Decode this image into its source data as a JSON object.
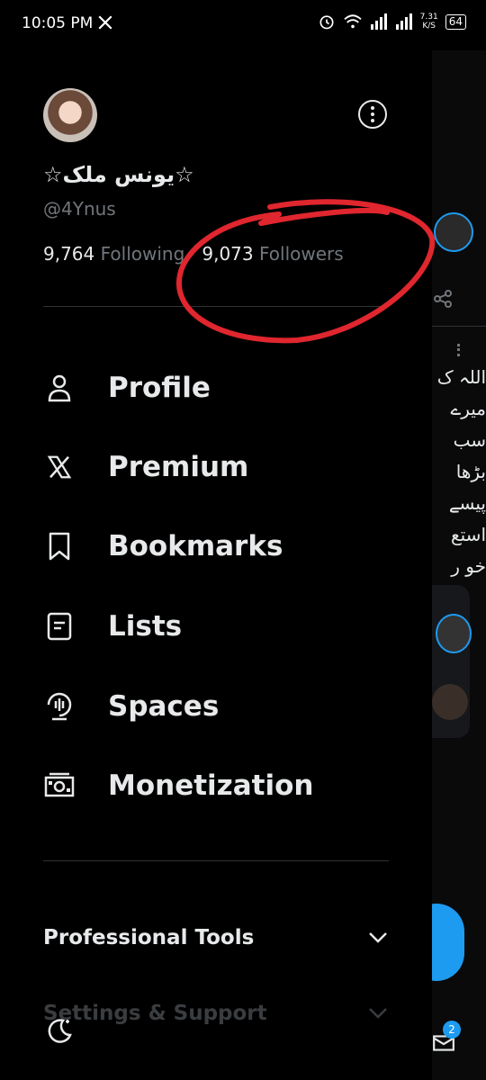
{
  "status_bar": {
    "time": "10:05 PM",
    "network_speed_value": "7.31",
    "network_speed_unit": "K/S",
    "battery": "64"
  },
  "profile": {
    "display_name": "☆یونس ملک☆",
    "handle": "@4Ynus",
    "following_count": "9,764",
    "following_label": "Following",
    "followers_count": "9,073",
    "followers_label": "Followers"
  },
  "nav": {
    "items": [
      {
        "label": "Profile",
        "icon": "person-icon"
      },
      {
        "label": "Premium",
        "icon": "x-logo-icon"
      },
      {
        "label": "Bookmarks",
        "icon": "bookmark-icon"
      },
      {
        "label": "Lists",
        "icon": "list-icon"
      },
      {
        "label": "Spaces",
        "icon": "spaces-icon"
      },
      {
        "label": "Monetization",
        "icon": "money-icon"
      }
    ]
  },
  "sections": {
    "professional_tools": "Professional Tools",
    "settings_support": "Settings & Support"
  },
  "underlay": {
    "urdu_lines": [
      "اللہ ک",
      "میرے",
      "سب",
      "بڑھا",
      "پیسے",
      "استع",
      "خو ر"
    ],
    "notification_badge": "2"
  },
  "colors": {
    "background": "#000000",
    "text_primary": "#e7e9ea",
    "text_secondary": "#71767b",
    "accent": "#1d9bf0",
    "annotation": "#e0262e"
  }
}
